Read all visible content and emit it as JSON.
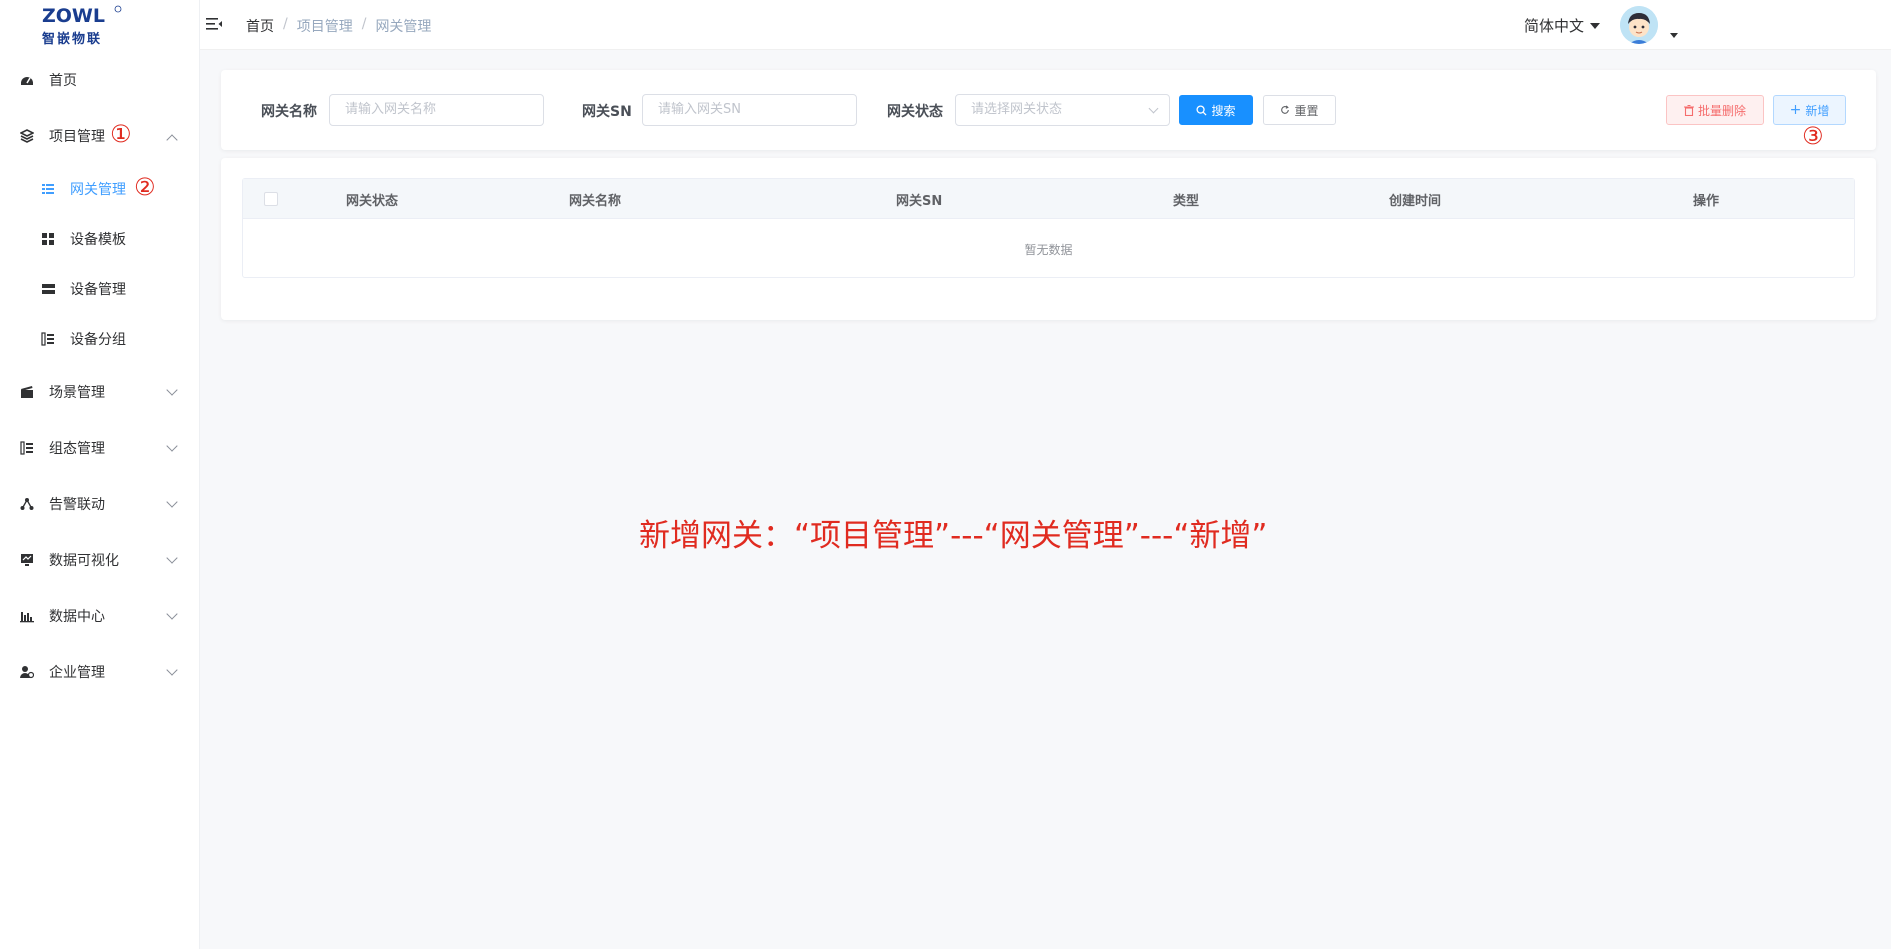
{
  "logo": {
    "mark": "ZOWL",
    "text": "智嵌物联"
  },
  "sidebar": {
    "items": [
      {
        "label": "首页",
        "icon": "dashboard-icon"
      },
      {
        "label": "项目管理",
        "icon": "layers-icon",
        "marker": "①"
      },
      {
        "label": "场景管理",
        "icon": "clapperboard-icon"
      },
      {
        "label": "组态管理",
        "icon": "list-tree-icon"
      },
      {
        "label": "告警联动",
        "icon": "network-icon"
      },
      {
        "label": "数据可视化",
        "icon": "monitor-chart-icon"
      },
      {
        "label": "数据中心",
        "icon": "bar-chart-icon"
      },
      {
        "label": "企业管理",
        "icon": "user-gear-icon"
      }
    ],
    "sub_items": [
      {
        "label": "网关管理",
        "icon": "list-icon",
        "marker": "②"
      },
      {
        "label": "设备模板",
        "icon": "grid-icon"
      },
      {
        "label": "设备管理",
        "icon": "server-icon"
      },
      {
        "label": "设备分组",
        "icon": "group-icon"
      }
    ]
  },
  "header": {
    "breadcrumb": [
      "首页",
      "项目管理",
      "网关管理"
    ],
    "separator": "/",
    "language": "简体中文"
  },
  "search": {
    "name_label": "网关名称",
    "name_placeholder": "请输入网关名称",
    "sn_label": "网关SN",
    "sn_placeholder": "请输入网关SN",
    "status_label": "网关状态",
    "status_placeholder": "请选择网关状态",
    "search_btn": "搜索",
    "reset_btn": "重置",
    "delete_btn": "批量删除",
    "add_btn": "新增",
    "add_marker": "③"
  },
  "table": {
    "columns": [
      "网关状态",
      "网关名称",
      "网关SN",
      "类型",
      "创建时间",
      "操作"
    ],
    "empty_text": "暂无数据"
  },
  "annotation": "新增网关：“项目管理”---“网关管理”---“新增”",
  "colors": {
    "primary": "#1890ff",
    "annotation": "#e02b20",
    "danger": "#f56c6c"
  }
}
